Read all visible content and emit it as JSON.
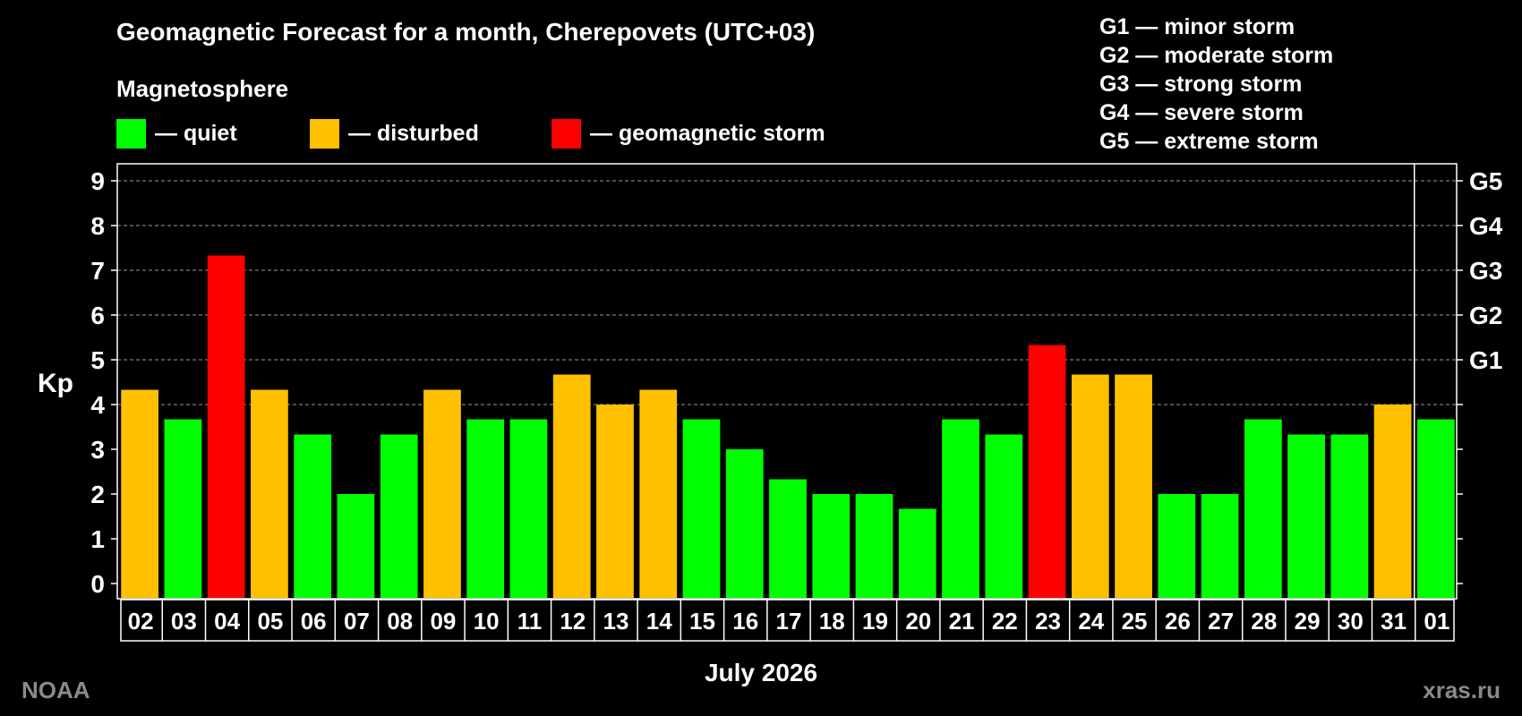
{
  "title": "Geomagnetic Forecast for a month, Cherepovets (UTC+03)",
  "legend": {
    "heading": "Magnetosphere",
    "items": [
      {
        "label": "— quiet",
        "color": "#00ff00"
      },
      {
        "label": "— disturbed",
        "color": "#ffc000"
      },
      {
        "label": "— geomagnetic storm",
        "color": "#ff0000"
      }
    ]
  },
  "g_legend": [
    "G1 — minor storm",
    "G2 — moderate storm",
    "G3 — strong storm",
    "G4 — severe storm",
    "G5 — extreme storm"
  ],
  "month_label": "July 2026",
  "credits": {
    "left": "NOAA",
    "right": "xras.ru"
  },
  "chart_data": {
    "type": "bar",
    "ylabel": "Kp",
    "ylim": [
      0,
      9
    ],
    "yticks": [
      0,
      1,
      2,
      3,
      4,
      5,
      6,
      7,
      8,
      9
    ],
    "right_axis": [
      {
        "value": 5,
        "label": "G1"
      },
      {
        "value": 6,
        "label": "G2"
      },
      {
        "value": 7,
        "label": "G3"
      },
      {
        "value": 8,
        "label": "G4"
      },
      {
        "value": 9,
        "label": "G5"
      }
    ],
    "grid": "dashed horizontal",
    "categories": [
      "02",
      "03",
      "04",
      "05",
      "06",
      "07",
      "08",
      "09",
      "10",
      "11",
      "12",
      "13",
      "14",
      "15",
      "16",
      "17",
      "18",
      "19",
      "20",
      "21",
      "22",
      "23",
      "24",
      "25",
      "26",
      "27",
      "28",
      "29",
      "30",
      "31",
      "01"
    ],
    "values": [
      4.33,
      3.67,
      7.33,
      4.33,
      3.33,
      2.0,
      3.33,
      4.33,
      3.67,
      3.67,
      4.67,
      4.0,
      4.33,
      3.67,
      3.0,
      2.33,
      2.0,
      2.0,
      1.67,
      3.67,
      3.33,
      5.33,
      4.67,
      4.67,
      2.0,
      2.0,
      3.67,
      3.33,
      3.33,
      4.0,
      3.67
    ],
    "colors": [
      "#ffc000",
      "#00ff00",
      "#ff0000",
      "#ffc000",
      "#00ff00",
      "#00ff00",
      "#00ff00",
      "#ffc000",
      "#00ff00",
      "#00ff00",
      "#ffc000",
      "#ffc000",
      "#ffc000",
      "#00ff00",
      "#00ff00",
      "#00ff00",
      "#00ff00",
      "#00ff00",
      "#00ff00",
      "#00ff00",
      "#00ff00",
      "#ff0000",
      "#ffc000",
      "#ffc000",
      "#00ff00",
      "#00ff00",
      "#00ff00",
      "#00ff00",
      "#00ff00",
      "#ffc000",
      "#00ff00"
    ]
  }
}
